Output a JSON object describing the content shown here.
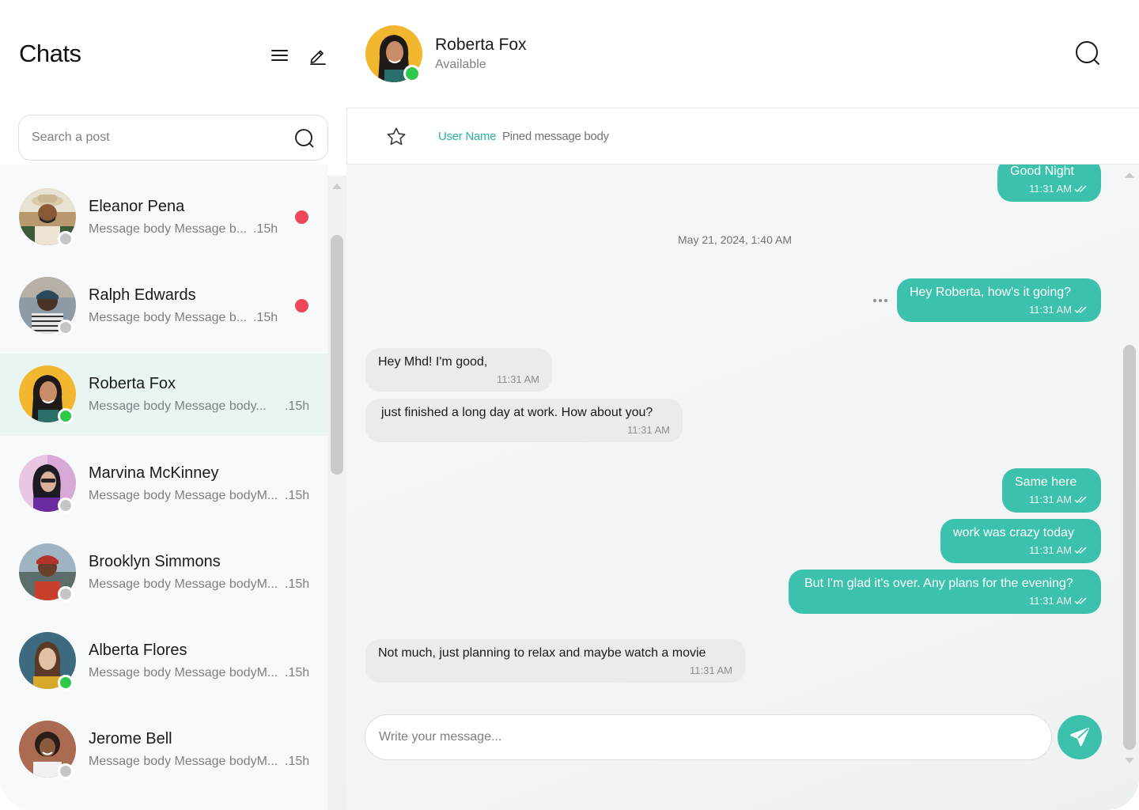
{
  "sidebar": {
    "title": "Chats",
    "menu_icon": "hamburger-menu-icon",
    "compose_icon": "pencil-edit-icon",
    "search": {
      "placeholder": "Search a post",
      "icon": "search-icon"
    },
    "chats": [
      {
        "name": "Eleanor Pena",
        "preview": "Message body Message b...",
        "time": ".15h",
        "status": "offline",
        "unread": true,
        "active": false
      },
      {
        "name": "Ralph Edwards",
        "preview": "Message body Message b...",
        "time": ".15h",
        "status": "offline",
        "unread": true,
        "active": false
      },
      {
        "name": "Roberta Fox",
        "preview": "Message body Message body...",
        "time": ".15h",
        "status": "online",
        "unread": false,
        "active": true
      },
      {
        "name": "Marvina McKinney",
        "preview": "Message body Message bodyM...",
        "time": ".15h",
        "status": "offline",
        "unread": false,
        "active": false
      },
      {
        "name": "Brooklyn Simmons",
        "preview": "Message body Message bodyM...",
        "time": ".15h",
        "status": "offline",
        "unread": false,
        "active": false
      },
      {
        "name": "Alberta Flores",
        "preview": "Message body Message bodyM...",
        "time": ".15h",
        "status": "online",
        "unread": false,
        "active": false
      },
      {
        "name": "Jerome Bell",
        "preview": "Message body Message bodyM...",
        "time": ".15h",
        "status": "offline",
        "unread": false,
        "active": false
      }
    ]
  },
  "conversation": {
    "contact_name": "Roberta Fox",
    "contact_status": "Available",
    "search_icon": "search-icon",
    "pinned": {
      "icon": "star-icon",
      "user": "User Name",
      "body": "Pined message body"
    },
    "date_separator": "May 21, 2024, 1:40 AM",
    "more_icon": "more-horizontal-icon",
    "messages": [
      {
        "direction": "out",
        "text": "Good Night",
        "time": "11:31 AM",
        "read": true
      },
      {
        "direction": "out",
        "text": "Hey Roberta, how's it going?",
        "time": "11:31 AM",
        "read": true
      },
      {
        "direction": "in",
        "text": "Hey Mhd! I'm good,",
        "time": "11:31 AM"
      },
      {
        "direction": "in",
        "text": "just finished a long day at work. How about you?",
        "time": "11:31 AM"
      },
      {
        "direction": "out",
        "text": "Same here",
        "time": "11:31 AM",
        "read": true
      },
      {
        "direction": "out",
        "text": "work was crazy today",
        "time": "11:31 AM",
        "read": true
      },
      {
        "direction": "out",
        "text": "But I'm glad it's over. Any plans for the evening?",
        "time": "11:31 AM",
        "read": true
      },
      {
        "direction": "in",
        "text": "Not much, just planning to relax and maybe watch a movie",
        "time": "11:31 AM"
      }
    ],
    "composer": {
      "placeholder": "Write your message...",
      "send_icon": "send-icon"
    }
  },
  "colors": {
    "accent": "#3cc1ad",
    "unread": "#f0465a",
    "online": "#2ec84a",
    "offline": "#c4c6c9",
    "active_row": "#e9f5f3"
  }
}
